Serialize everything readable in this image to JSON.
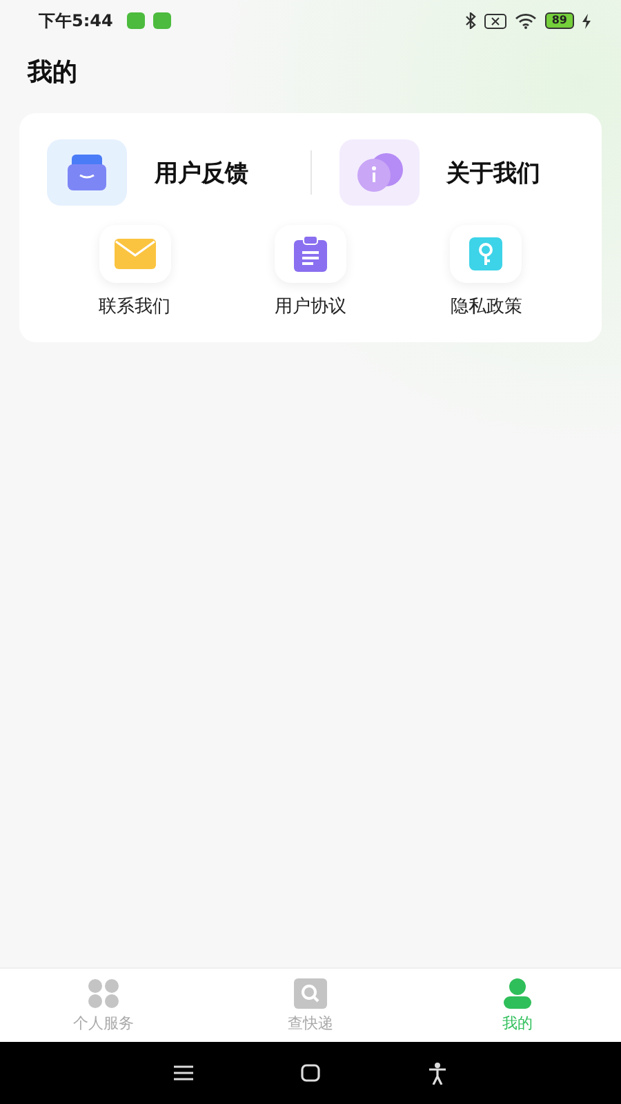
{
  "status_bar": {
    "time": "下午5:44",
    "battery": "89"
  },
  "title": "我的",
  "featured": [
    {
      "label": "用户反馈",
      "kind": "feedback"
    },
    {
      "label": "关于我们",
      "kind": "about"
    }
  ],
  "shortcuts": [
    {
      "label": "联系我们",
      "kind": "mail"
    },
    {
      "label": "用户协议",
      "kind": "clipboard"
    },
    {
      "label": "隐私政策",
      "kind": "key"
    }
  ],
  "tabs": [
    {
      "label": "个人服务",
      "kind": "grid",
      "selected": false
    },
    {
      "label": "查快递",
      "kind": "search",
      "selected": false
    },
    {
      "label": "我的",
      "kind": "person",
      "selected": true
    }
  ]
}
